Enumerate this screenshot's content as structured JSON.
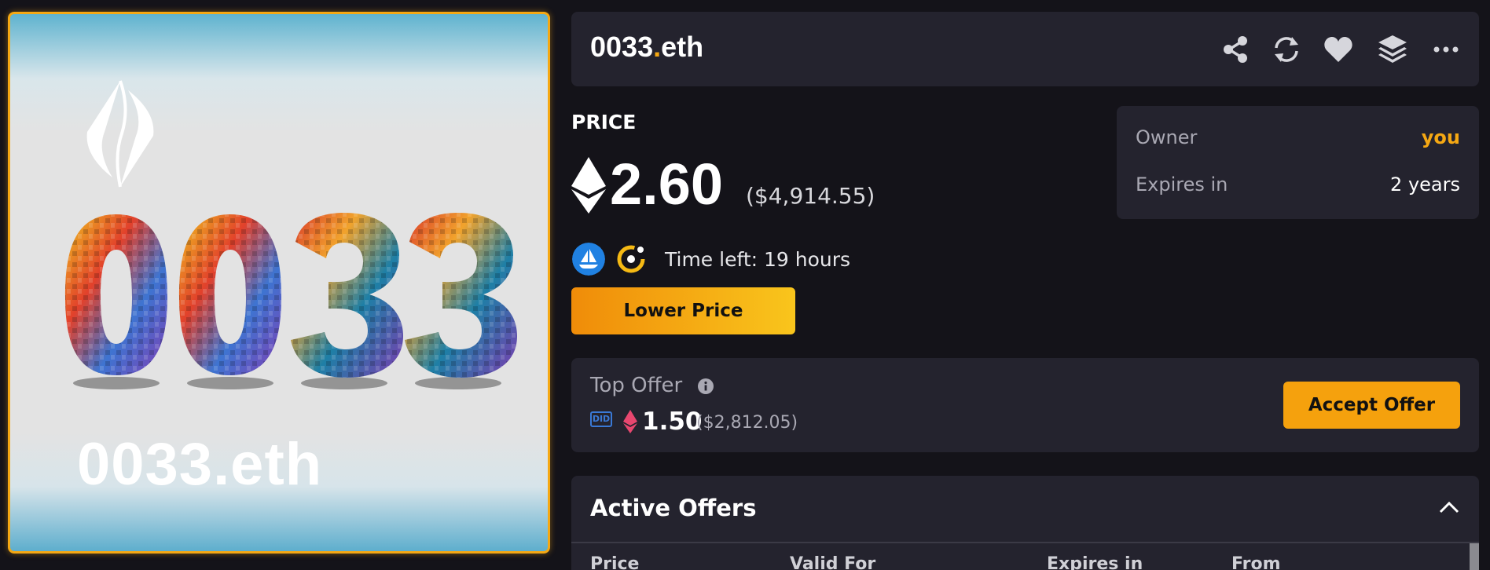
{
  "card": {
    "name": "0033.eth",
    "art_text": "0033"
  },
  "header": {
    "domain_name": "0033",
    "domain_dot": ".",
    "domain_tld": "eth",
    "icons": [
      "share-icon",
      "refresh-icon",
      "heart-icon",
      "layers-icon",
      "more-icon"
    ]
  },
  "price": {
    "label": "PRICE",
    "value": "2.60",
    "usd": "($4,914.55)"
  },
  "owner_box": {
    "owner_label": "Owner",
    "owner_value": "you",
    "expires_label": "Expires in",
    "expires_value": "2 years"
  },
  "listing": {
    "time_left": "Time left:  19 hours",
    "lower_price_label": "Lower Price"
  },
  "top_offer": {
    "title": "Top Offer",
    "badge": "DID",
    "price": "1.50",
    "usd": "($2,812.05)",
    "accept_label": "Accept Offer"
  },
  "active_offers": {
    "title": "Active Offers",
    "columns": [
      "Price",
      "Valid For",
      "Expires in",
      "From"
    ]
  },
  "colors": {
    "accent": "#f5a813",
    "background": "#141319",
    "panel": "#24232e",
    "eth_pink": "#e8476f",
    "opensea_blue": "#2081e2"
  }
}
